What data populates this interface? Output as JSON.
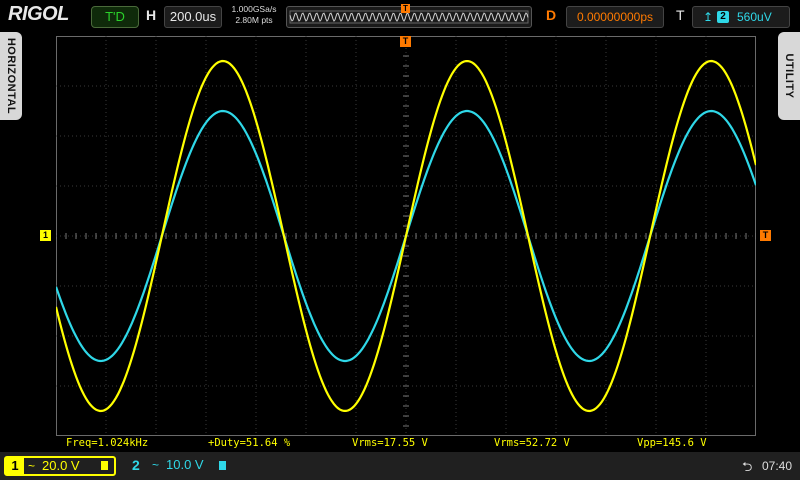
{
  "header": {
    "brand": "RIGOL",
    "run_state": "T'D",
    "horizontal_label": "H",
    "timebase": "200.0us",
    "sample_rate": "1.000GSa/s",
    "memory_depth": "2.80M pts",
    "delay_label": "D",
    "delay": "0.00000000ps",
    "trigger_label": "T",
    "trigger_source": "2",
    "trigger_level": "560uV",
    "trigger_edge_icon": "rising-edge-icon"
  },
  "side_tabs": {
    "left": "HORIZONTAL",
    "right": "UTILITY"
  },
  "markers": {
    "ch1_ground": "1",
    "trigger_level": "T",
    "trigger_position": "T"
  },
  "measurements": [
    {
      "text": "Freq=1.024kHz"
    },
    {
      "text": "+Duty=51.64 %"
    },
    {
      "text": "Vrms=17.55 V"
    },
    {
      "text": "Vrms=52.72 V"
    },
    {
      "text": "Vpp=145.6 V"
    }
  ],
  "channels": {
    "ch1": {
      "number": "1",
      "coupling": "~",
      "scale": "20.0 V"
    },
    "ch2": {
      "number": "2",
      "coupling": "~",
      "scale": "10.0 V"
    }
  },
  "status": {
    "usb_icon": "usb-icon",
    "time": "07:40"
  },
  "colors": {
    "ch1": "#ffff00",
    "ch2": "#2fd8e8",
    "trigger": "#ff7a00",
    "grid": "#3a3a3a"
  },
  "waveforms": {
    "frequency_khz": 1.024,
    "ch1": {
      "amplitude_div": 3.5,
      "center_div": 0
    },
    "ch2": {
      "amplitude_div": 2.5,
      "center_div": 0
    }
  }
}
